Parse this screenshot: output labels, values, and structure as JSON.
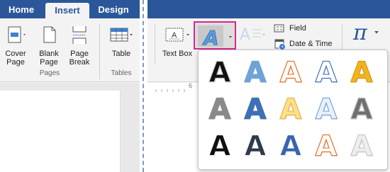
{
  "tabs": [
    {
      "label": "Home"
    },
    {
      "label": "Insert"
    },
    {
      "label": "Design"
    }
  ],
  "pages_group": {
    "label": "Pages",
    "buttons": [
      {
        "label_l1": "Cover",
        "label_l2": "Page"
      },
      {
        "label_l1": "Blank",
        "label_l2": "Page"
      },
      {
        "label_l1": "Page",
        "label_l2": "Break"
      }
    ]
  },
  "tables_group": {
    "label": "Tables",
    "button": "Table"
  },
  "text_group": {
    "text_box": "Text Box",
    "field": "Field",
    "date_time": "Date & Time"
  },
  "equation_symbol": "π",
  "ruler_mark": "6",
  "wordart": {
    "letter": "A",
    "styles": [
      {
        "fill": "#111111",
        "stroke": "#cfcfcf"
      },
      {
        "fill": "#6fa3d8",
        "stroke": "#6fa3d8"
      },
      {
        "fill": "#ffffff",
        "stroke": "#e8732a"
      },
      {
        "fill": "#ffffff",
        "stroke": "#4a78b8"
      },
      {
        "fill": "#f2b320",
        "stroke": "#d99a10"
      },
      {
        "fill": "#8a8a8a",
        "stroke": "#8a8a8a"
      },
      {
        "fill": "#3f6fb4",
        "stroke": "#3f6fb4"
      },
      {
        "fill": "#fbe08a",
        "stroke": "#e9b54a"
      },
      {
        "fill": "#e8f1fb",
        "stroke": "#7fa8d6"
      },
      {
        "fill": "#707070",
        "stroke": "#bfbfbf"
      },
      {
        "fill": "#111111",
        "stroke": "#ffffff"
      },
      {
        "fill": "#2f3b4b",
        "stroke": "#ffffff"
      },
      {
        "fill": "#3565ad",
        "stroke": "#ffffff"
      },
      {
        "fill": "#ffffff",
        "stroke": "#e8732a"
      },
      {
        "fill": "#eeeeee",
        "stroke": "#c8c8c8"
      }
    ]
  }
}
